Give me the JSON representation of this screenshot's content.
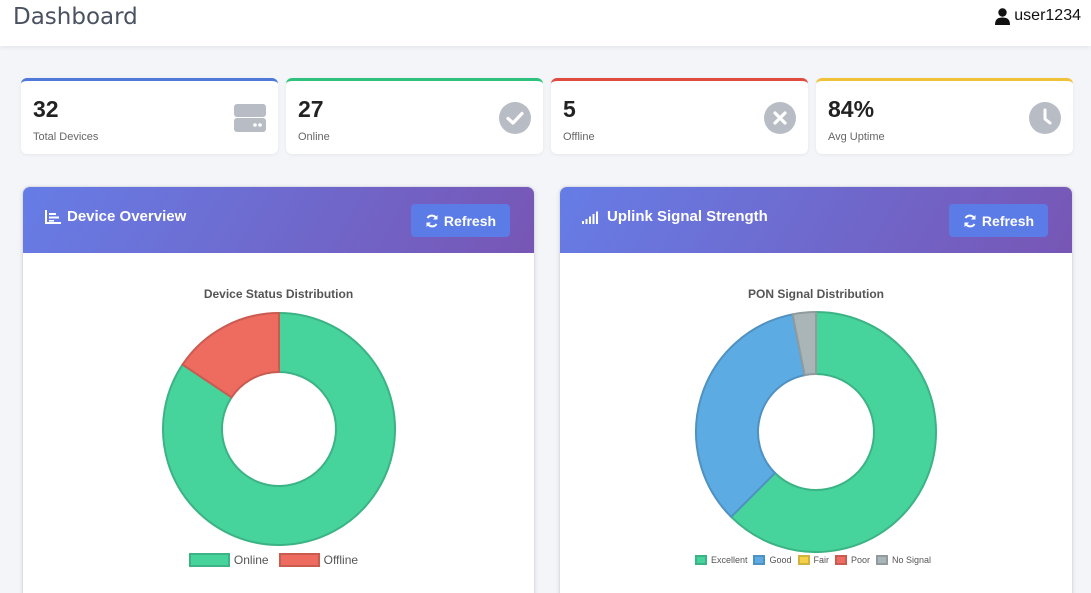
{
  "header": {
    "title": "Dashboard",
    "username": "user1234"
  },
  "stats": [
    {
      "value": "32",
      "label": "Total Devices",
      "icon": "server-icon",
      "accent": "#4f79d9"
    },
    {
      "value": "27",
      "label": "Online",
      "icon": "check-circle-icon",
      "accent": "#2ec27e"
    },
    {
      "value": "5",
      "label": "Offline",
      "icon": "x-circle-icon",
      "accent": "#e04b40"
    },
    {
      "value": "84%",
      "label": "Avg Uptime",
      "icon": "clock-icon",
      "accent": "#f0c23a"
    }
  ],
  "device_card": {
    "title": "Device Overview",
    "refresh_label": "Refresh",
    "chart_title": "Device Status Distribution"
  },
  "signal_card": {
    "title": "Uplink Signal Strength",
    "refresh_label": "Refresh",
    "chart_title": "PON Signal Distribution"
  },
  "chart_data": [
    {
      "type": "pie",
      "title": "Device Status Distribution",
      "categories": [
        "Online",
        "Offline"
      ],
      "values": [
        27,
        5
      ],
      "colors": [
        "#47d39c",
        "#ee6b5f"
      ],
      "legend": "bottom"
    },
    {
      "type": "pie",
      "title": "PON Signal Distribution",
      "categories": [
        "Excellent",
        "Good",
        "Fair",
        "Poor",
        "No Signal"
      ],
      "values": [
        20,
        11,
        0,
        0,
        1
      ],
      "colors": [
        "#47d39c",
        "#5dabe3",
        "#f5d14a",
        "#ee6b5f",
        "#aab5b8"
      ],
      "legend": "bottom"
    }
  ]
}
